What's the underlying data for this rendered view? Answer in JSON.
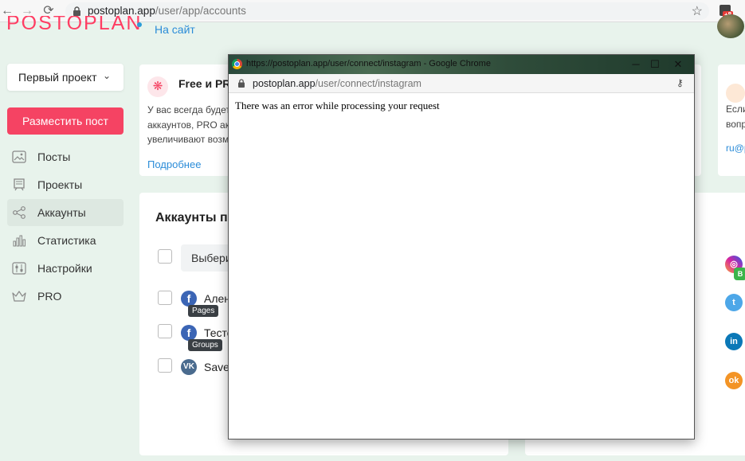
{
  "browser": {
    "url_host": "postoplan.app",
    "url_path": "/user/app/accounts",
    "ext_badge": "+8"
  },
  "header": {
    "logo": "POSTOPLAN",
    "site_link": "На сайт"
  },
  "sidebar": {
    "project_select": "Первый проект",
    "post_button": "Разместить пост",
    "items": [
      {
        "label": "Посты",
        "icon": "image-icon"
      },
      {
        "label": "Проекты",
        "icon": "board-icon"
      },
      {
        "label": "Аккаунты",
        "icon": "share-icon",
        "active": true
      },
      {
        "label": "Статистика",
        "icon": "bar-chart-icon"
      },
      {
        "label": "Настройки",
        "icon": "sliders-icon"
      },
      {
        "label": "PRO",
        "icon": "crown-icon"
      }
    ]
  },
  "promo_card": {
    "title": "Free и PRO",
    "lines": [
      "У вас всегда будет",
      "аккаунтов, PRO ак",
      "увеличивают возм"
    ],
    "link": "Подробнее"
  },
  "accounts_card": {
    "title": "Аккаунты пр",
    "select_placeholder": "Выбери",
    "accounts": [
      {
        "name": "Алене",
        "network": "facebook",
        "tag": "Pages"
      },
      {
        "name": "Тесто",
        "network": "facebook",
        "tag": "Groups"
      },
      {
        "name": "Saved",
        "network": "vk",
        "tag": ""
      }
    ]
  },
  "right_card": {
    "lines": [
      "Если",
      "вопр"
    ],
    "link": "ru@p"
  },
  "social_list": [
    "instagram",
    "twitter",
    "linkedin",
    "odnoklassniki"
  ],
  "social_badge": "B",
  "popup": {
    "window_title": "https://postoplan.app/user/connect/instagram - Google Chrome",
    "url_host": "postoplan.app",
    "url_path": "/user/connect/instagram",
    "message": "There was an error while processing your request"
  }
}
